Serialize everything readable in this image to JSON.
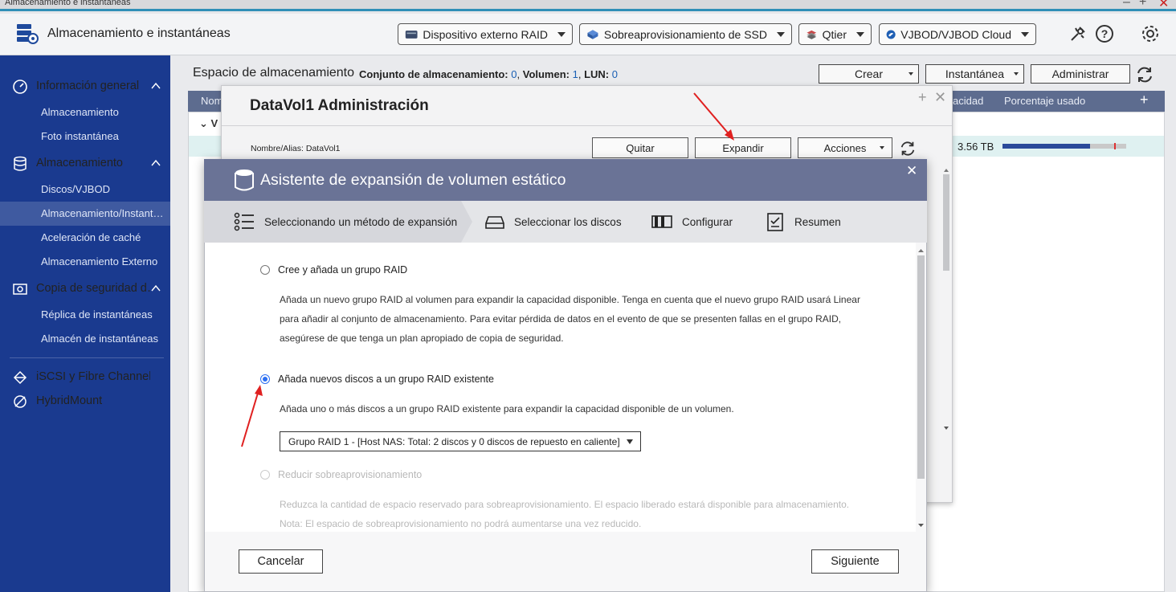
{
  "window": {
    "title": "Almacenamiento e instantáneas"
  },
  "header": {
    "app_title": "Almacenamiento e instantáneas",
    "buttons": [
      {
        "label": "Dispositivo externo RAID",
        "icon": "external-raid-icon"
      },
      {
        "label": "Sobreaprovisionamiento de SSD",
        "icon": "ssd-icon"
      },
      {
        "label": "Qtier",
        "icon": "qtier-icon"
      },
      {
        "label": "VJBOD/VJBOD Cloud",
        "icon": "vjbod-cloud-icon"
      }
    ]
  },
  "sidebar": {
    "sections": [
      {
        "label": "Información general",
        "icon": "dashboard-icon",
        "items": [
          "Almacenamiento",
          "Foto instantánea"
        ]
      },
      {
        "label": "Almacenamiento",
        "icon": "database-icon",
        "items": [
          "Discos/VJBOD",
          "Almacenamiento/Instant…",
          "Aceleración de caché",
          "Almacenamiento Externo"
        ]
      },
      {
        "label": "Copia de seguridad d…",
        "icon": "snapshot-backup-icon",
        "items": [
          "Réplica de instantáneas",
          "Almacén de instantáneas"
        ]
      }
    ],
    "extra": [
      {
        "label": "iSCSI y Fibre Channel",
        "icon": "iscsi-icon"
      },
      {
        "label": "HybridMount",
        "icon": "hybridmount-icon"
      }
    ]
  },
  "main": {
    "title": "Espacio de almacenamiento",
    "summary": {
      "pool_label": "Conjunto de almacenamiento:",
      "pool_count": "0",
      "volume_label": "Volumen:",
      "volume_count": "1",
      "lun_label": "LUN:",
      "lun_count": "0"
    },
    "buttons": {
      "create": "Crear",
      "snapshot": "Instantánea",
      "manage": "Administrar"
    },
    "table": {
      "col_name": "Nom",
      "col_capacity": "acidad",
      "col_usage": "Porcentaje usado",
      "group_label": "V",
      "row_capacity": "3.56 TB",
      "row_usage_pct": 71
    }
  },
  "admin_dialog": {
    "title": "DataVol1  Administración",
    "alias": "Nombre/Alias: DataVol1",
    "buttons": {
      "remove": "Quitar",
      "expand": "Expandir",
      "actions": "Acciones"
    }
  },
  "wizard": {
    "title": "Asistente de expansión de volumen estático",
    "steps": [
      {
        "label": "Seleccionando un método de expansión",
        "icon": "list-icon"
      },
      {
        "label": "Seleccionar los discos",
        "icon": "disk-icon"
      },
      {
        "label": "Configurar",
        "icon": "configure-icon"
      },
      {
        "label": "Resumen",
        "icon": "summary-clipboard-icon"
      }
    ],
    "options": [
      {
        "label": "Cree y añada un grupo RAID",
        "desc": [
          "Añada un nuevo grupo RAID al volumen para expandir la capacidad disponible. Tenga en cuenta que el nuevo grupo RAID usará Linear",
          "para añadir al conjunto de almacenamiento. Para evitar pérdida de datos en el evento de que se presenten fallas en el grupo RAID,",
          "asegúrese de que tenga un plan apropiado de copia de seguridad."
        ]
      },
      {
        "label": "Añada nuevos discos a un grupo RAID existente",
        "desc": [
          "Añada uno o más discos a un grupo RAID existente para expandir la capacidad disponible de un volumen."
        ]
      },
      {
        "label": "Reducir sobreaprovisionamiento",
        "desc": [
          "Reduzca la cantidad de espacio reservado para sobreaprovisionamiento. El espacio liberado estará disponible para almacenamiento.",
          "Nota: El espacio de sobreaprovisionamiento no podrá aumentarse una vez reducido."
        ]
      }
    ],
    "raid_select": "Grupo RAID 1 -  [Host NAS: Total: 2 discos y 0 discos de repuesto en caliente]",
    "cancel": "Cancelar",
    "next": "Siguiente"
  },
  "colors": {
    "sidebar_bg": "#1a3a8f",
    "wizard_header": "#6a7396",
    "radio_selected": "#2c6ff2",
    "annotation_arrow": "#e02020"
  }
}
